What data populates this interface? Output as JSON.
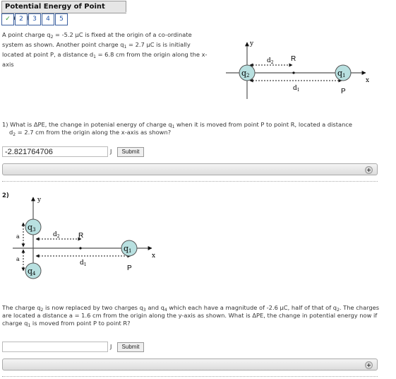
{
  "header": {
    "title": "Potential Energy of Point Charges"
  },
  "tabs": [
    {
      "label": "✓",
      "status": "completed"
    },
    {
      "label": "2"
    },
    {
      "label": "3"
    },
    {
      "label": "4"
    },
    {
      "label": "5"
    }
  ],
  "intro": {
    "p1": "A point charge q",
    "p1_sub": "2",
    "p2": " = -5.2 μC is fixed at the origin of a co-ordinate system as shown. Another point charge q",
    "p2_sub": "1",
    "p3": " = 2.7 μC is is initially located at point P, a distance d",
    "p3_sub": "1",
    "p4": " = 6.8 cm from the origin along the x-axis"
  },
  "diagram1": {
    "y_label": "y",
    "x_label": "x",
    "q2": "q",
    "q2_sub": "2",
    "q1": "q",
    "q1_sub": "1",
    "d2": "d",
    "d2_sub": "2",
    "d1": "d",
    "d1_sub": "1",
    "R": "R",
    "P": "P",
    "circle_fill": "#b8e0e0"
  },
  "question1": {
    "a": "1) What is ΔPE, the change in potenial energy of charge q",
    "a_sub": "1",
    "b": " when it is moved from point P to point R, located a distance",
    "c": "d",
    "c_sub": "2",
    "d": " = 2.7 cm from the origin along the x-axis as shown?",
    "answer_value": "-2.821764706",
    "unit": "J",
    "submit_label": "Submit"
  },
  "question2": {
    "number": "2)",
    "a": "The charge q",
    "a_sub": "2",
    "b": " is now replaced by two charges q",
    "b_sub": "3",
    "c": " and q",
    "c_sub": "4",
    "d": " which each have a magnitude of -2.6 μC, half of that of q",
    "d_sub": "2",
    "e": ". The charges are located a distance a = 1.6 cm from the origin along the y-axis as shown. What is ΔPE, the change in potential energy now if charge q",
    "e_sub": "1",
    "f": " is moved from point P to point R?",
    "answer_value": "",
    "unit": "J",
    "submit_label": "Submit"
  },
  "diagram2": {
    "y_label": "y",
    "x_label": "x",
    "q3": "q",
    "q3_sub": "3",
    "q4": "q",
    "q4_sub": "4",
    "q1": "q",
    "q1_sub": "1",
    "a_top": "a",
    "a_bottom": "a",
    "d2": "d",
    "d2_sub": "2",
    "d1": "d",
    "d1_sub": "1",
    "R": "R",
    "P": "P"
  },
  "hint_icon": "plus-circle-icon"
}
